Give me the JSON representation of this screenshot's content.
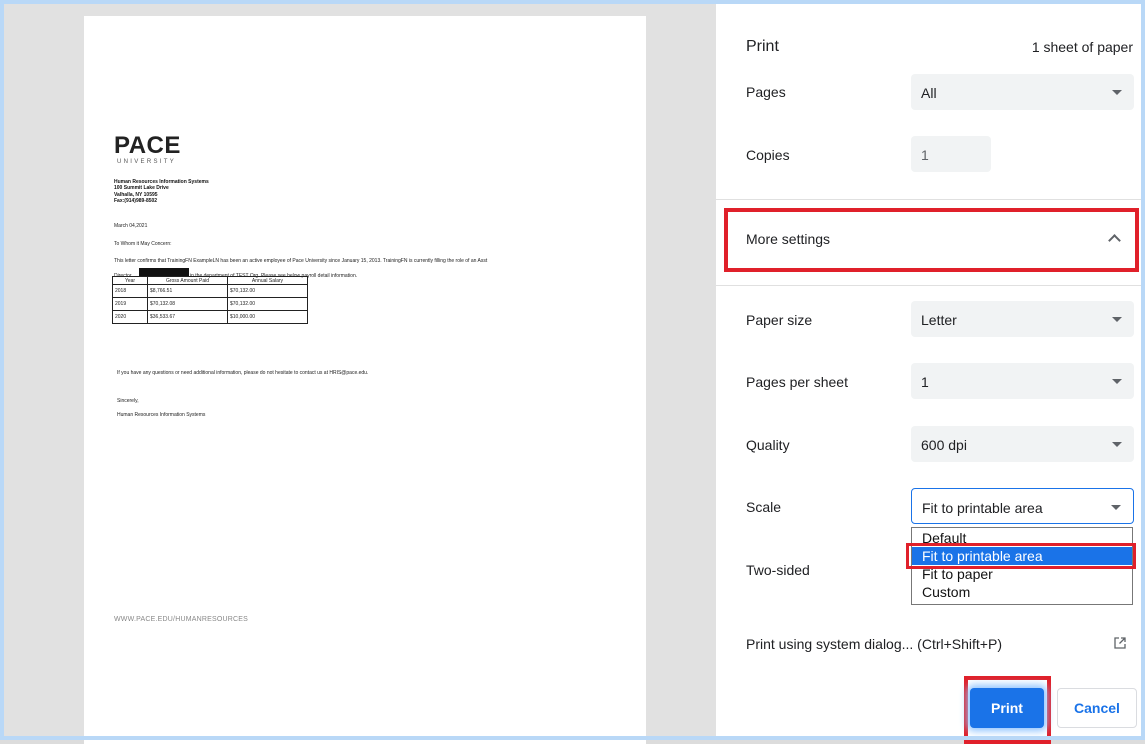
{
  "preview": {
    "logo_main": "PACE",
    "logo_sub": "UNIVERSITY",
    "address": [
      "Human Resources Information Systems",
      "100 Summit Lake Drive",
      "Valhalla, NY 10595",
      "Fax:(914)989-8502"
    ],
    "date": "March 04,2021",
    "greeting": "To Whom it May Concern:",
    "body_line1": "This letter confirms that TrainingFN ExampleLN has been an active employee of Pace University since January 15, 2013.  TrainingFN is currently filling the role of an Asst",
    "body_line2_start": "Director",
    "body_line2_end": "in the department of TEST Org. Please see below payroll detail information.",
    "table": {
      "headers": [
        "Year",
        "Gross Amount Paid",
        "Annual Salary"
      ],
      "rows": [
        [
          "2018",
          "$8,766.51",
          "$70,132.00"
        ],
        [
          "2019",
          "$70,132.08",
          "$70,132.00"
        ],
        [
          "2020",
          "$36,533.67",
          "$10,000.00"
        ]
      ]
    },
    "closing_line": "If you have any questions or need additional information, please do not hesitate to contact us at HRIS@pace.edu.",
    "sincerely": "Sincerely,",
    "signature": "Human Resources Information Systems",
    "footer_url": "WWW.PACE.EDU/HUMANRESOURCES"
  },
  "panel": {
    "title": "Print",
    "sheet_count": "1 sheet of paper",
    "pages_label": "Pages",
    "pages_value": "All",
    "copies_label": "Copies",
    "copies_value": "1",
    "more_settings": "More settings",
    "paper_size_label": "Paper size",
    "paper_size_value": "Letter",
    "pages_per_sheet_label": "Pages per sheet",
    "pages_per_sheet_value": "1",
    "quality_label": "Quality",
    "quality_value": "600 dpi",
    "scale_label": "Scale",
    "scale_value": "Fit to printable area",
    "scale_options": [
      "Default",
      "Fit to printable area",
      "Fit to paper",
      "Custom"
    ],
    "two_sided_label": "Two-sided",
    "system_dialog": "Print using system dialog... (Ctrl+Shift+P)",
    "print_button": "Print",
    "cancel_button": "Cancel"
  },
  "colors": {
    "accent": "#1a73e8",
    "highlight_box": "#e0202a"
  }
}
